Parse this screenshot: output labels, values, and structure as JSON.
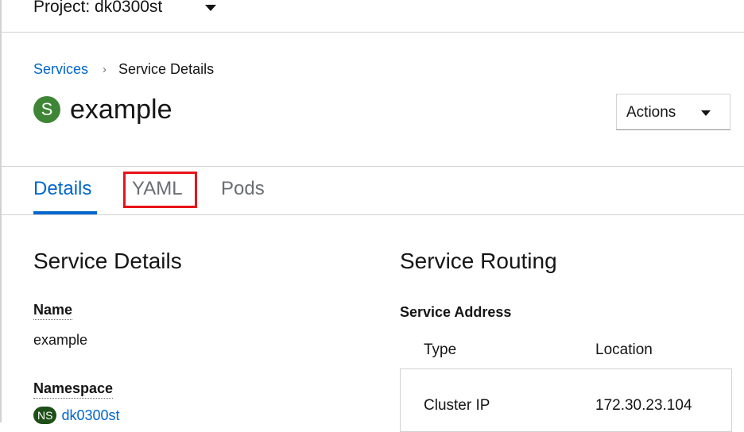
{
  "project": {
    "label": "Project: dk0300st"
  },
  "breadcrumb": {
    "parent": "Services",
    "separator": "›",
    "current": "Service Details"
  },
  "header": {
    "badge": "S",
    "title": "example",
    "actions_label": "Actions"
  },
  "tabs": [
    {
      "label": "Details",
      "active": true
    },
    {
      "label": "YAML",
      "active": false
    },
    {
      "label": "Pods",
      "active": false
    }
  ],
  "details": {
    "title": "Service Details",
    "name_label": "Name",
    "name_value": "example",
    "namespace_label": "Namespace",
    "namespace_badge": "NS",
    "namespace_value": "dk0300st"
  },
  "routing": {
    "title": "Service Routing",
    "address_label": "Service Address",
    "columns": [
      "Type",
      "Location"
    ],
    "rows": [
      {
        "type": "Cluster IP",
        "location": "172.30.23.104"
      }
    ]
  },
  "colors": {
    "accent": "#0066cc",
    "badge_service": "#3e8635",
    "badge_ns": "#1e4f18",
    "highlight": "#e8141a"
  }
}
